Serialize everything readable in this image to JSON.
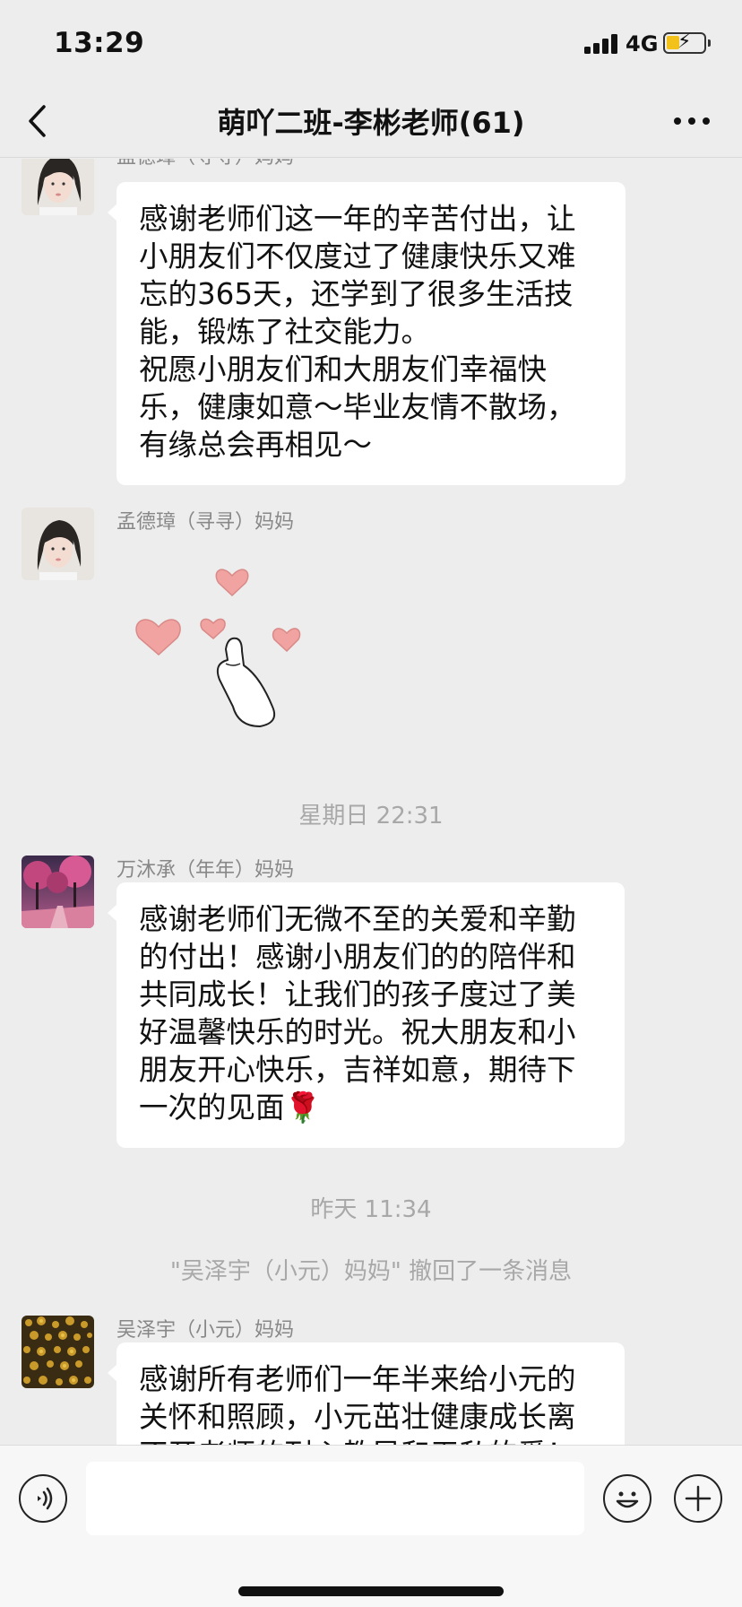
{
  "status_bar": {
    "time": "13:29",
    "network": "4G",
    "battery_level": 0.35
  },
  "header": {
    "title": "萌吖二班-李彬老师(61)",
    "back_icon": "chevron-left-icon",
    "more_icon": "more-dots-icon"
  },
  "messages": [
    {
      "sender": "孟德璋（寻寻）妈妈",
      "avatar": "girl-portrait",
      "text": "感谢老师们这一年的辛苦付出，让\n小朋友们不仅度过了健康快乐又难\n忘的365天，还学到了很多生活技\n能，锻炼了社交能力。\n祝愿小朋友们和大朋友们幸福快\n乐，健康如意～毕业友情不散场，\n有缘总会再相见～"
    },
    {
      "sender": "孟德璋（寻寻）妈妈",
      "avatar": "girl-portrait",
      "sticker": "hearts-finger-sticker"
    },
    {
      "sender": "万沐承（年年）妈妈",
      "avatar": "pink-trees-photo",
      "text": "感谢老师们无微不至的关爱和辛勤\n的付出！感谢小朋友们的的陪伴和\n共同成长！让我们的孩子度过了美\n好温馨快乐的时光。祝大朋友和小\n朋友开心快乐，吉祥如意，期待下\n一次的见面🌹"
    },
    {
      "sender": "吴泽宇（小元）妈妈",
      "avatar": "yellow-flowers-photo",
      "text": "感谢所有老师们一年半来给小元的\n关怀和照顾，小元茁壮健康成长离\n不开老师的耐心教导和无私的爱！"
    }
  ],
  "separators": {
    "time_1": "星期日 22:31",
    "time_2": "昨天 11:34",
    "recall_notice": "\"吴泽宇（小元）妈妈\" 撤回了一条消息"
  },
  "input_bar": {
    "voice_icon": "voice-icon",
    "emoji_icon": "emoji-icon",
    "plus_icon": "plus-icon",
    "placeholder": ""
  },
  "colors": {
    "background": "#ededed",
    "bubble": "#ffffff",
    "heart": "#f0a3a1",
    "battery": "#f2c21b"
  }
}
